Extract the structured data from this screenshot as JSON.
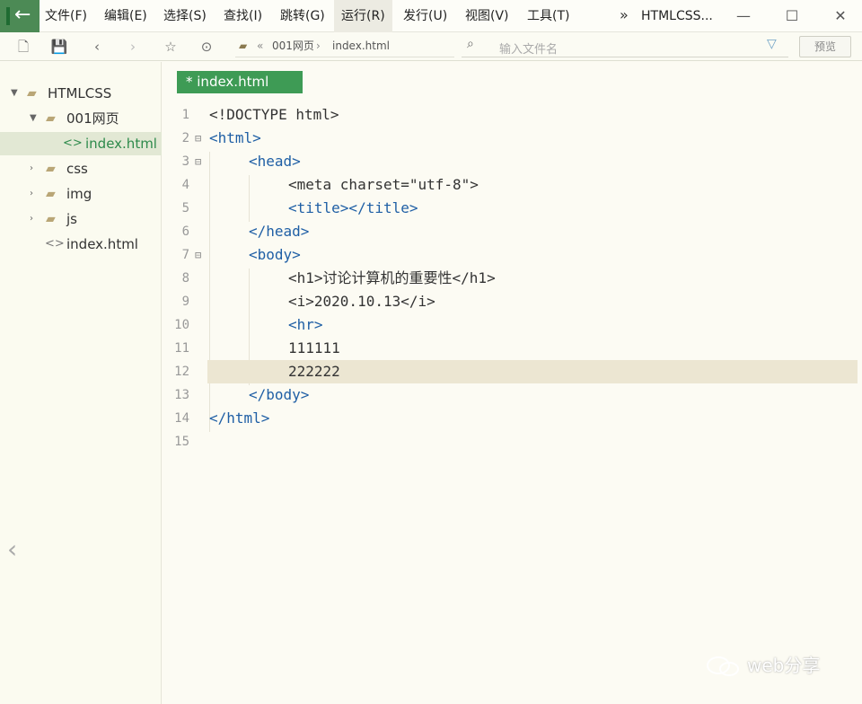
{
  "menubar": {
    "items": [
      "文件(F)",
      "编辑(E)",
      "选择(S)",
      "查找(I)",
      "跳转(G)",
      "运行(R)",
      "发行(U)",
      "视图(V)",
      "工具(T)"
    ],
    "title": "HTMLCSS..."
  },
  "toolbar": {
    "breadcrumb": [
      "001网页",
      "index.html"
    ],
    "filter_placeholder": "输入文件名",
    "preview_label": "预览"
  },
  "sidebar": {
    "tree": [
      {
        "label": "HTMLCSS",
        "type": "project",
        "expanded": true
      },
      {
        "label": "001网页",
        "type": "folder",
        "expanded": true
      },
      {
        "label": "index.html",
        "type": "file",
        "selected": true
      },
      {
        "label": "css",
        "type": "folder",
        "expanded": false
      },
      {
        "label": "img",
        "type": "folder",
        "expanded": false
      },
      {
        "label": "js",
        "type": "folder",
        "expanded": false
      },
      {
        "label": "index.html",
        "type": "file",
        "selected": false
      }
    ]
  },
  "editor": {
    "tab_label": "* index.html",
    "line_numbers": [
      "1",
      "2",
      "3",
      "4",
      "5",
      "6",
      "7",
      "8",
      "9",
      "10",
      "11",
      "12",
      "13",
      "14",
      "15"
    ],
    "lines": [
      "<!DOCTYPE html>",
      "<html>",
      "<head>",
      "<meta charset=\"utf-8\">",
      "<title></title>",
      "</head>",
      "<body>",
      "<h1>讨论计算机的重要性</h1>",
      "<i>2020.10.13</i>",
      "<hr>",
      "111111",
      "222222",
      "</body>",
      "</html>",
      ""
    ],
    "current_line": 12
  },
  "watermark": "web分享",
  "colors": {
    "accent": "#3e9b55",
    "tag": "#1f5fa5",
    "attribute": "#b35b1d",
    "string": "#3d8b3d",
    "current_line": "#ece6d2"
  }
}
